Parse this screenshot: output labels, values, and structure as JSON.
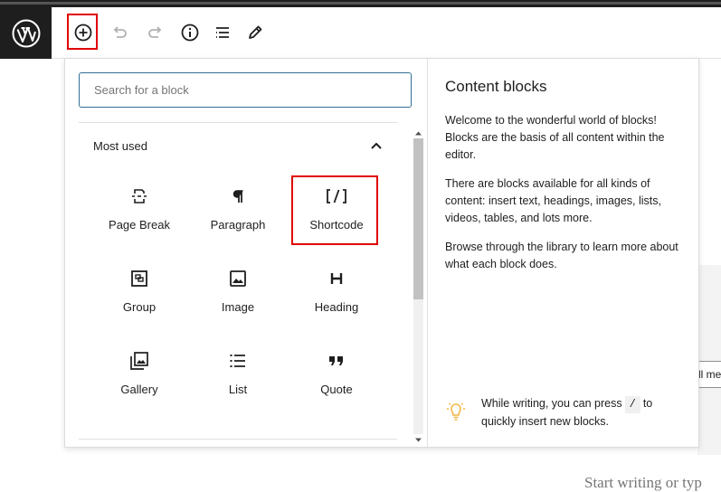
{
  "toolbar": {
    "logo_icon": "wordpress-logo-icon",
    "buttons": [
      {
        "name": "add-block",
        "icon": "plus-circle-icon"
      },
      {
        "name": "undo",
        "icon": "undo-icon"
      },
      {
        "name": "redo",
        "icon": "redo-icon"
      },
      {
        "name": "details",
        "icon": "info-icon"
      },
      {
        "name": "outline",
        "icon": "list-view-icon"
      },
      {
        "name": "tools",
        "icon": "pencil-icon"
      }
    ]
  },
  "inserter": {
    "search_placeholder": "Search for a block",
    "section_title": "Most used",
    "blocks": [
      {
        "label": "Page Break",
        "icon": "page-break-icon"
      },
      {
        "label": "Paragraph",
        "icon": "paragraph-icon"
      },
      {
        "label": "Shortcode",
        "icon": "shortcode-icon"
      },
      {
        "label": "Group",
        "icon": "group-icon"
      },
      {
        "label": "Image",
        "icon": "image-icon"
      },
      {
        "label": "Heading",
        "icon": "heading-icon"
      },
      {
        "label": "Gallery",
        "icon": "gallery-icon"
      },
      {
        "label": "List",
        "icon": "list-icon"
      },
      {
        "label": "Quote",
        "icon": "quote-icon"
      }
    ]
  },
  "help": {
    "title": "Content blocks",
    "p1": "Welcome to the wonderful world of blocks! Blocks are the basis of all content within the editor.",
    "p2": "There are blocks available for all kinds of content: insert text, headings, images, lists, videos, tables, and lots more.",
    "p3": "Browse through the library to learn more about what each block does.",
    "tip_before": "While writing, you can press",
    "tip_key": "/",
    "tip_after": "to quickly insert new blocks."
  },
  "background": {
    "input_fragment": "ll me",
    "editor_placeholder_fragment": "Start writing or typ"
  },
  "colors": {
    "highlight": "#e00000",
    "search_border": "#2f6f94",
    "tip_icon": "#f0b849"
  }
}
